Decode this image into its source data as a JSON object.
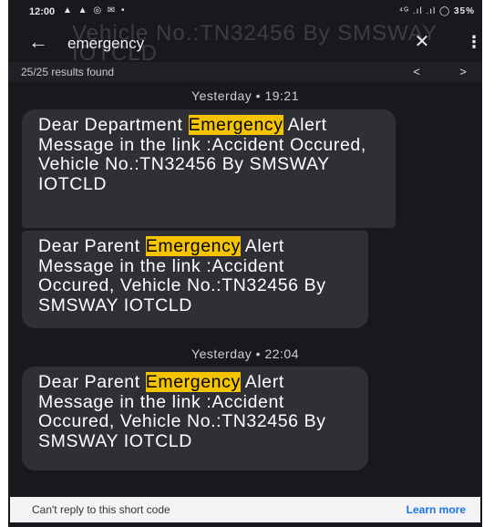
{
  "status_bar": {
    "time": "12:00",
    "left_icons": "▲ ▲ ◎ ✉ •",
    "right_icons": "⁴ᴳ .ıl .ıl ◯",
    "battery": "35%"
  },
  "search": {
    "value": "emergency",
    "ghost_text": "Vehicle No.:TN32456 By SMSWAY IOTCLD"
  },
  "results": {
    "count_text": "25/25 results found"
  },
  "groups": [
    {
      "date": "Yesterday • 19:21"
    },
    {
      "date": "Yesterday • 22:04"
    }
  ],
  "messages": [
    {
      "before": "Dear Department ",
      "highlight": "Emergency",
      "after": " Alert Message in the link :Accident Occured, Vehicle No.:TN32456 By SMSWAY IOTCLD"
    },
    {
      "before": "Dear Parent ",
      "highlight": "Emergency",
      "after": " Alert Message in the link :Accident Occured, Vehicle No.:TN32456 By SMSWAY IOTCLD"
    },
    {
      "before": "Dear Parent ",
      "highlight": "Emergency",
      "after": " Alert Message in the link :Accident Occured, Vehicle No.:TN32456 By SMSWAY IOTCLD"
    }
  ],
  "footer": {
    "notice": "Can't reply to this short code",
    "learn_more": "Learn more"
  },
  "colors": {
    "background": "#17191d",
    "bubble": "#2e3035",
    "highlight": "#f5c400",
    "link": "#1a73e8"
  },
  "icons": [
    "back-arrow-icon",
    "close-icon",
    "more-vert-icon",
    "chevron-left-icon",
    "chevron-right-icon"
  ]
}
